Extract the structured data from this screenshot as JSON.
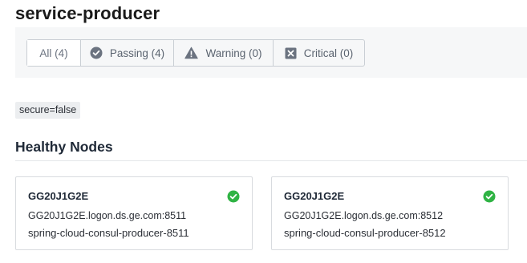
{
  "page": {
    "title": "service-producer"
  },
  "filters": [
    {
      "label": "All (4)",
      "icon": "none",
      "active": true
    },
    {
      "label": "Passing (4)",
      "icon": "check-circle-icon",
      "active": false
    },
    {
      "label": "Warning (0)",
      "icon": "warning-triangle-icon",
      "active": false
    },
    {
      "label": "Critical (0)",
      "icon": "x-square-icon",
      "active": false
    }
  ],
  "tags": [
    "secure=false"
  ],
  "section": {
    "title": "Healthy Nodes"
  },
  "nodes": [
    {
      "name": "GG20J1G2E",
      "address": "GG20J1G2E.logon.ds.ge.com:8511",
      "service": "spring-cloud-consul-producer-8511",
      "status_icon": "check-circle-icon"
    },
    {
      "name": "GG20J1G2E",
      "address": "GG20J1G2E.logon.ds.ge.com:8512",
      "service": "spring-cloud-consul-producer-8512",
      "status_icon": "check-circle-icon"
    }
  ],
  "colors": {
    "passing": "#2fb344",
    "filter_icon": "#6b7380",
    "filter_bar_bg": "#f6f7f8"
  }
}
